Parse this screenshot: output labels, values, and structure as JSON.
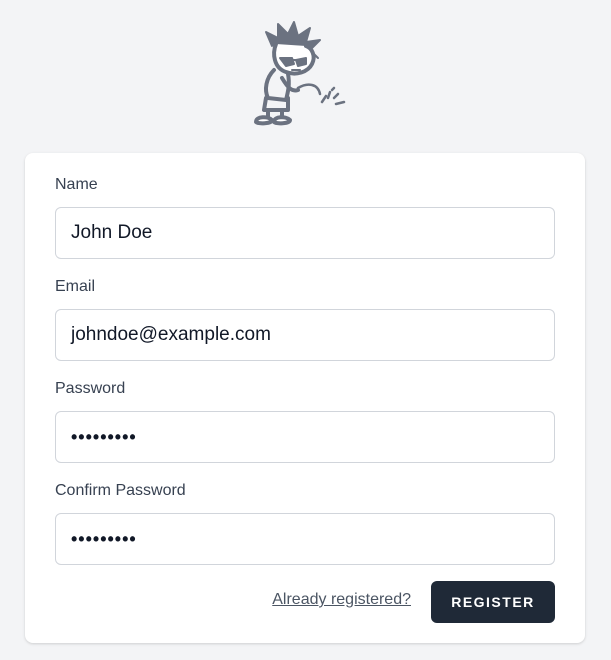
{
  "logo": {
    "icon": "peeing-boy-logo-icon"
  },
  "form": {
    "name": {
      "label": "Name",
      "value": "John Doe"
    },
    "email": {
      "label": "Email",
      "value": "johndoe@example.com"
    },
    "password": {
      "label": "Password",
      "value": "•••••••••"
    },
    "confirm_password": {
      "label": "Confirm Password",
      "value": "•••••••••"
    }
  },
  "actions": {
    "login_link": "Already registered?",
    "register_button": "REGISTER"
  },
  "colors": {
    "background": "#f3f4f6",
    "card": "#ffffff",
    "button": "#1f2937",
    "input_border": "#d1d5db",
    "logo": "#6b7280"
  }
}
